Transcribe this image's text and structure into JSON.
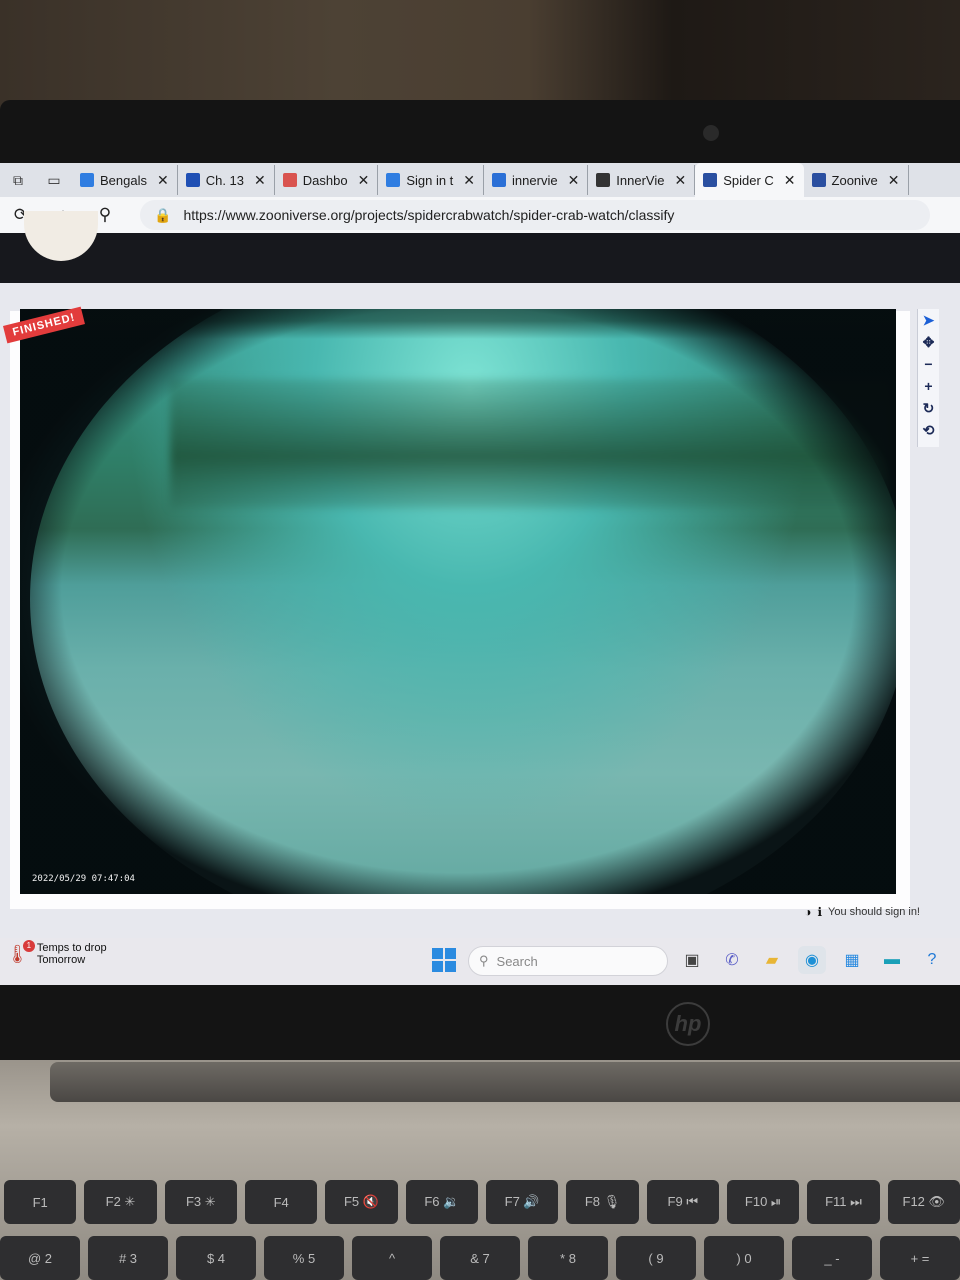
{
  "browser": {
    "tabs": [
      {
        "label": "Bengals",
        "favicon": "ms-tiles-icon",
        "color": "#2f7de1"
      },
      {
        "label": "Ch. 13",
        "favicon": "word-icon",
        "color": "#1f4fb4"
      },
      {
        "label": "Dashbo",
        "favicon": "canvas-icon",
        "color": "#d9534f"
      },
      {
        "label": "Sign in t",
        "favicon": "ms-tiles-icon",
        "color": "#2f7de1"
      },
      {
        "label": "innervie",
        "favicon": "search-icon",
        "color": "#2a6fd6"
      },
      {
        "label": "InnerVie",
        "favicon": "paw-icon",
        "color": "#333333"
      },
      {
        "label": "Spider C",
        "favicon": "zooniverse-icon",
        "color": "#2a4fa0",
        "active": true
      },
      {
        "label": "Zoonive",
        "favicon": "zooniverse-icon",
        "color": "#2a4fa0"
      }
    ],
    "url": "https://www.zooniverse.org/projects/spidercrabwatch/spider-crab-watch/classify"
  },
  "classifier": {
    "banner": "FINISHED!",
    "timestamp": "2022/05/29 07:47:04",
    "tools": [
      "pointer",
      "move",
      "zoom-out",
      "zoom-in",
      "reset",
      "rotate"
    ],
    "sign_in_note": "You should sign in!"
  },
  "taskbar": {
    "weather_title": "Temps to drop",
    "weather_sub": "Tomorrow",
    "weather_badge": "1",
    "search_placeholder": "Search"
  },
  "keyboard": {
    "fkeys": [
      "F1",
      "F2 ✳",
      "F3 ✳",
      "F4",
      "F5 🔇",
      "F6 🔉",
      "F7 🔊",
      "F8 🎙",
      "F9 ⏮",
      "F10 ⏯",
      "F11 ⏭",
      "F12 👁"
    ],
    "numkeys": [
      "@ 2",
      "# 3",
      "$ 4",
      "% 5",
      "^",
      "& 7",
      "* 8",
      "( 9",
      ") 0",
      "_ -",
      "+ ="
    ]
  }
}
